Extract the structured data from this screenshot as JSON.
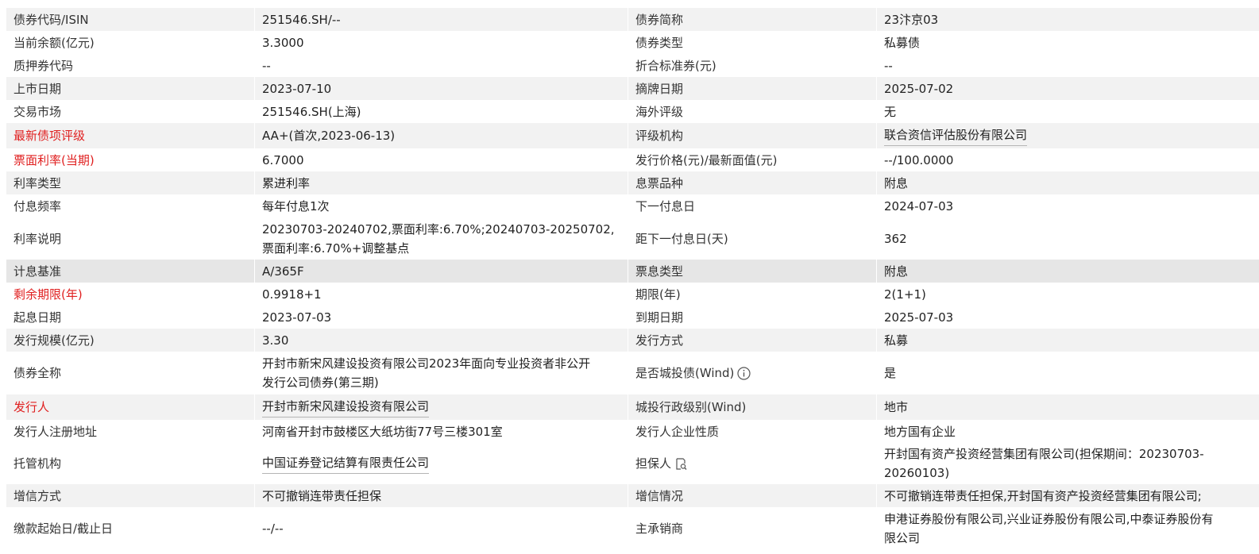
{
  "rows": [
    {
      "l1": "债券代码/ISIN",
      "v1": "251546.SH/--",
      "l2": "债券简称",
      "v2": "23汴京03"
    },
    {
      "l1": "当前余额(亿元)",
      "v1": "3.3000",
      "l2": "债券类型",
      "v2": "私募债"
    },
    {
      "l1": "质押券代码",
      "v1": "--",
      "l2": "折合标准券(元)",
      "v2": "--"
    },
    {
      "l1": "上市日期",
      "v1": "2023-07-10",
      "l2": "摘牌日期",
      "v2": "2025-07-02"
    },
    {
      "l1": "交易市场",
      "v1": "251546.SH(上海)",
      "l2": "海外评级",
      "v2": "无"
    },
    {
      "l1": "最新债项评级",
      "v1": "AA+(首次,2023-06-13)",
      "l2": "评级机构",
      "v2": "联合资信评估股份有限公司"
    },
    {
      "l1": "票面利率(当期)",
      "v1": "6.7000",
      "l2": "发行价格(元)/最新面值(元)",
      "v2": "--/100.0000"
    },
    {
      "l1": "利率类型",
      "v1": "累进利率",
      "l2": "息票品种",
      "v2": "附息"
    },
    {
      "l1": "付息频率",
      "v1": "每年付息1次",
      "l2": "下一付息日",
      "v2": "2024-07-03"
    },
    {
      "l1": "利率说明",
      "v1a": "20230703-20240702,票面利率:6.70%;20240703-20250702,",
      "v1b": "票面利率:6.70%+调整基点",
      "l2": "距下一付息日(天)",
      "v2": "362"
    },
    {
      "l1": "计息基准",
      "v1": "A/365F",
      "l2": "票息类型",
      "v2": "附息"
    },
    {
      "l1": "剩余期限(年)",
      "v1": "0.9918+1",
      "l2": "期限(年)",
      "v2": "2(1+1)"
    },
    {
      "l1": "起息日期",
      "v1": "2023-07-03",
      "l2": "到期日期",
      "v2": "2025-07-03"
    },
    {
      "l1": "发行规模(亿元)",
      "v1": "3.30",
      "l2": "发行方式",
      "v2": "私募"
    },
    {
      "l1": "债券全称",
      "v1a": "开封市新宋风建设投资有限公司2023年面向专业投资者非公开",
      "v1b": "发行公司债券(第三期)",
      "l2": "是否城投债(Wind)",
      "v2": "是"
    },
    {
      "l1": "发行人",
      "v1": "开封市新宋风建设投资有限公司",
      "l2": "城投行政级别(Wind)",
      "v2": "地市"
    },
    {
      "l1": "发行人注册地址",
      "v1": "河南省开封市鼓楼区大纸坊街77号三楼301室",
      "l2": "发行人企业性质",
      "v2": "地方国有企业"
    },
    {
      "l1": "托管机构",
      "v1": "中国证券登记结算有限责任公司",
      "l2": "担保人",
      "v2a": "开封国有资产投资经营集团有限公司(担保期间：20230703-",
      "v2b": "20260103)"
    },
    {
      "l1": "增信方式",
      "v1": "不可撤销连带责任担保",
      "l2": "增信情况",
      "v2": "不可撤销连带责任担保,开封国有资产投资经营集团有限公司;"
    },
    {
      "l1": "缴款起始日/截止日",
      "v1": "--/--",
      "l2": "主承销商",
      "v2a": "申港证券股份有限公司,兴业证券股份有限公司,中泰证券股份有",
      "v2b": "限公司"
    }
  ],
  "icons": {
    "info": "info-circle-icon",
    "guarantor": "document-search-icon"
  },
  "colors": {
    "red_label": "#e02020",
    "row_gray": "#f2f2f2",
    "row_dark": "#e6e6e6"
  }
}
